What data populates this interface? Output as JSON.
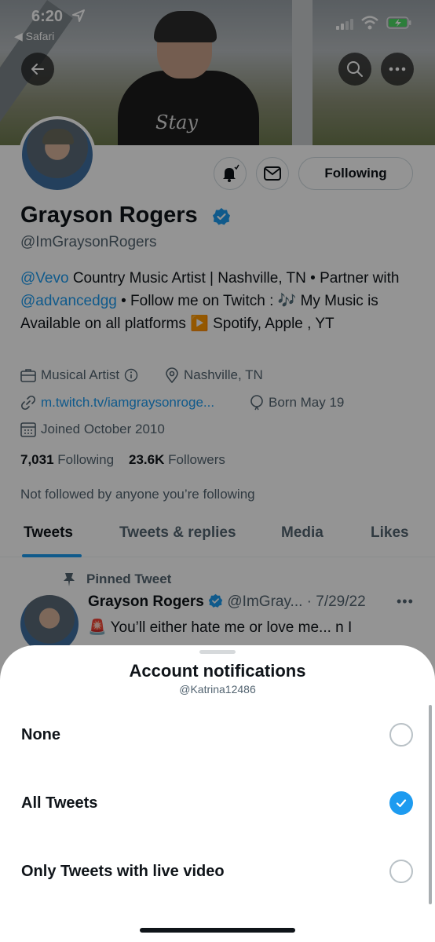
{
  "status_bar": {
    "time": "6:20",
    "back_app": "◀ Safari"
  },
  "profile": {
    "name": "Grayson Rogers",
    "handle": "@ImGraysonRogers",
    "bio": {
      "mention1": "@Vevo",
      "text1": " Country Music Artist | Nashville, TN • Partner with ",
      "mention2": "@advancedgg",
      "text2": " • Follow me on Twitch : 🎶 My Music is Available on all platforms ▶️ Spotify, Apple , YT"
    },
    "category": "Musical Artist",
    "location": "Nashville, TN",
    "website": "m.twitch.tv/iamgraysonroge...",
    "birthday": "Born May 19",
    "joined": "Joined October 2010",
    "following_count": "7,031",
    "following_label": "Following",
    "followers_count": "23.6K",
    "followers_label": "Followers",
    "not_followed": "Not followed by anyone you’re following",
    "following_button": "Following"
  },
  "tabs": [
    "Tweets",
    "Tweets & replies",
    "Media",
    "Likes"
  ],
  "pinned_tweet": {
    "label": "Pinned Tweet",
    "author": "Grayson Rogers",
    "handle_date": "@ImGray... · 7/29/22",
    "text": "🚨 You’ll either hate me or love me... n I"
  },
  "sheet": {
    "title": "Account notifications",
    "subtitle": "@Katrina12486",
    "options": [
      {
        "label": "None",
        "checked": false
      },
      {
        "label": "All Tweets",
        "checked": true
      },
      {
        "label": "Only Tweets with live video",
        "checked": false
      }
    ]
  },
  "colors": {
    "accent": "#1d9bf0",
    "text": "#0f1419",
    "muted": "#536471"
  },
  "icons": [
    "back-arrow-icon",
    "search-icon",
    "more-icon",
    "bell-icon",
    "mail-icon",
    "verified-icon",
    "briefcase-icon",
    "info-icon",
    "location-icon",
    "link-icon",
    "balloon-icon",
    "calendar-icon",
    "pin-icon",
    "check-icon"
  ]
}
